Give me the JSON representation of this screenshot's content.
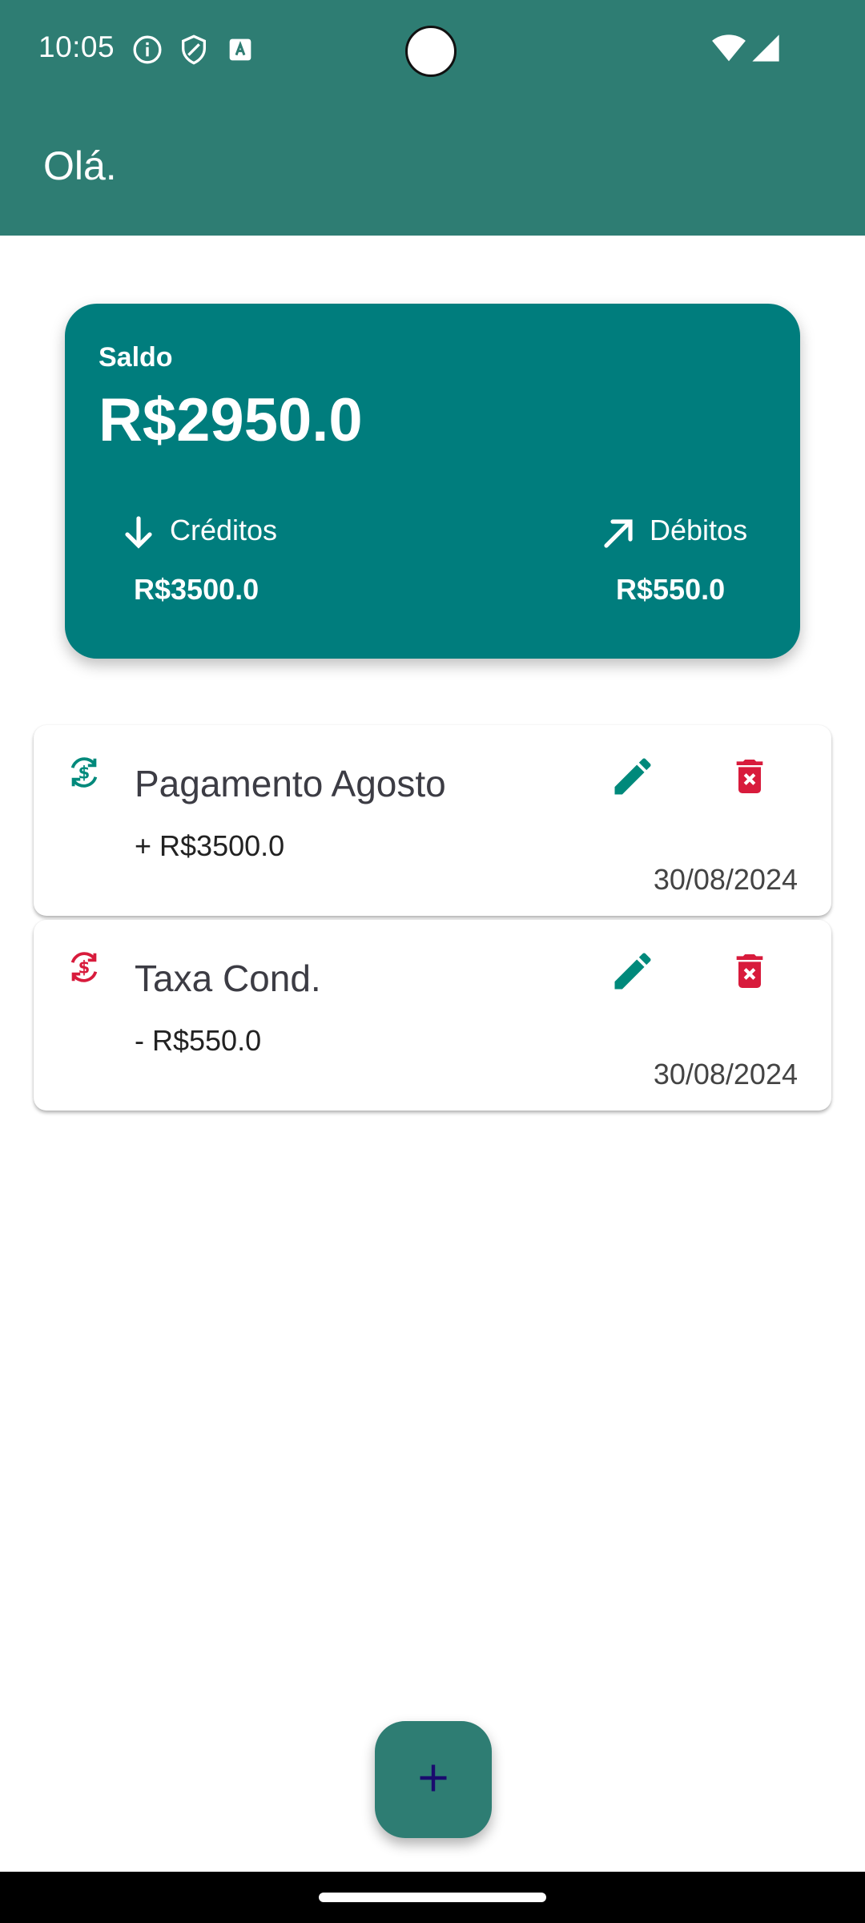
{
  "status_bar": {
    "time": "10:05",
    "icons": [
      "info-icon",
      "shield-icon",
      "font-icon",
      "wifi-icon",
      "signal-icon"
    ]
  },
  "app_bar": {
    "greeting": "Olá."
  },
  "balance_card": {
    "label": "Saldo",
    "value": "R$2950.0",
    "credits": {
      "label": "Créditos",
      "value": "R$3500.0",
      "icon": "arrow-down-icon"
    },
    "debits": {
      "label": "Débitos",
      "value": "R$550.0",
      "icon": "arrow-up-right-icon"
    }
  },
  "transactions": [
    {
      "title": "Pagamento Agosto",
      "amount": "+ R$3500.0",
      "date": "30/08/2024",
      "kind": "credit",
      "color": "#00897b"
    },
    {
      "title": "Taxa Cond.",
      "amount": "- R$550.0",
      "date": "30/08/2024",
      "kind": "debit",
      "color": "#d81b3c"
    }
  ],
  "colors": {
    "primary": "#2e7d73",
    "card": "#007d7d",
    "edit": "#00897b",
    "delete": "#d81b3c",
    "fab_icon": "#1a0b6e"
  },
  "fab": {
    "icon": "plus-icon"
  }
}
